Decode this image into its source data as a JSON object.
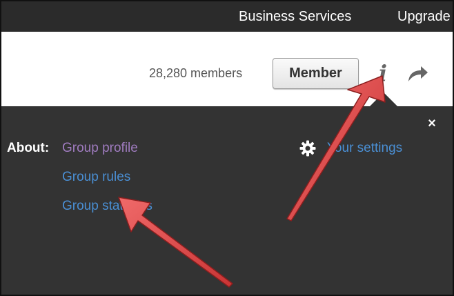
{
  "topnav": {
    "business_label": "Business Services",
    "upgrade_label": "Upgrade"
  },
  "group_header": {
    "members_count": "28,280 members",
    "member_button_label": "Member",
    "info_icon": "i"
  },
  "about_panel": {
    "close_symbol": "×",
    "about_label": "About:",
    "links": {
      "profile": "Group profile",
      "rules": "Group rules",
      "statistics": "Group statistics"
    },
    "settings_label": "Your settings"
  },
  "colors": {
    "topbar_bg": "#2b2b2b",
    "panel_bg": "#333333",
    "link_blue": "#4a8fd4",
    "link_visited": "#a07cc0",
    "arrow_red": "#e04545"
  },
  "icons": {
    "info": "info-icon",
    "share": "share-icon",
    "close": "close-icon",
    "settings": "gear-icon",
    "annotation": "arrow-icon"
  }
}
